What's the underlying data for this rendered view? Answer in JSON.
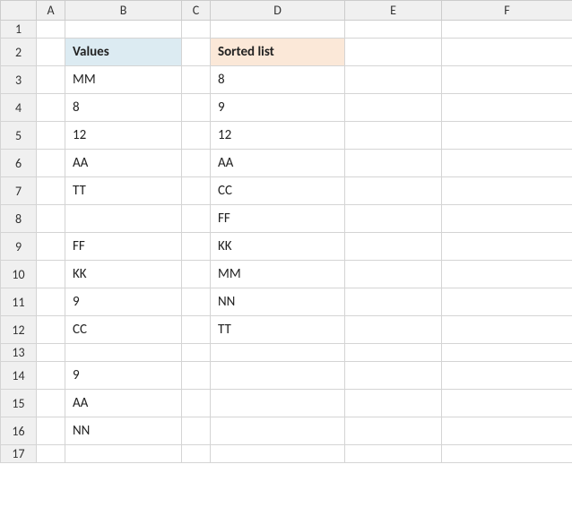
{
  "columns": [
    "A",
    "B",
    "C",
    "D",
    "E",
    "F"
  ],
  "row_numbers": [
    "1",
    "2",
    "3",
    "4",
    "5",
    "6",
    "7",
    "8",
    "9",
    "10",
    "11",
    "12",
    "13",
    "14",
    "15",
    "16",
    "17"
  ],
  "headers": {
    "values": "Values",
    "sorted": "Sorted list"
  },
  "column_b": [
    "MM",
    "8",
    "12",
    "AA",
    "TT",
    "",
    "FF",
    "KK",
    "9",
    "CC",
    "",
    "9",
    "AA",
    "NN"
  ],
  "column_d": [
    "8",
    "9",
    "12",
    "AA",
    "CC",
    "FF",
    "KK",
    "MM",
    "NN",
    "TT"
  ],
  "chart_data": {
    "type": "table",
    "title": "",
    "series": [
      {
        "name": "Values",
        "values": [
          "MM",
          "8",
          "12",
          "AA",
          "TT",
          "",
          "FF",
          "KK",
          "9",
          "CC",
          "",
          "9",
          "AA",
          "NN"
        ]
      },
      {
        "name": "Sorted list",
        "values": [
          "8",
          "9",
          "12",
          "AA",
          "CC",
          "FF",
          "KK",
          "MM",
          "NN",
          "TT"
        ]
      }
    ]
  }
}
